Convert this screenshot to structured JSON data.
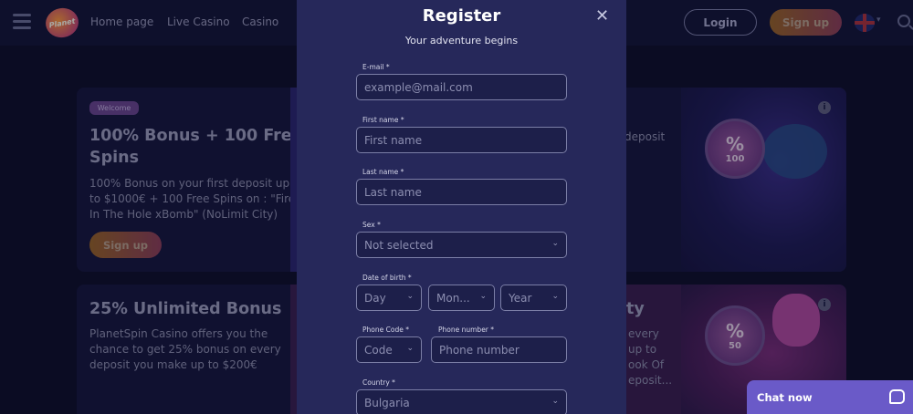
{
  "header": {
    "logo_text": "Planet",
    "nav": [
      "Home page",
      "Live Casino",
      "Casino"
    ],
    "login_label": "Login",
    "signup_label": "Sign up",
    "language_icon": "uk-flag-icon",
    "search_icon": "search-icon"
  },
  "promos": [
    {
      "badge": "Welcome",
      "title_line1": "100% Bonus + 100 Free",
      "title_line2": "Spins",
      "desc_lines": [
        "100% Bonus on your first deposit up",
        "to $1000€ + 100 Free Spins on : \"Fire",
        "In The Hole xBomb\" (NoLimit City)"
      ],
      "button": "Sign up",
      "side_text": "deposit",
      "coin_value": "100",
      "coin_symbol": "%"
    },
    {
      "title_line1": "25% Unlimited Bonus",
      "desc_lines": [
        "PlanetSpin Casino offers you the",
        "chance to get 25% bonus on every",
        "deposit you make up to $200€"
      ],
      "side_title": "ty",
      "side_lines": [
        "every",
        "up to",
        "ook Of",
        "eposit..."
      ],
      "coin_value": "50",
      "coin_symbol": "%"
    }
  ],
  "info_glyph": "i",
  "modal": {
    "title": "Register",
    "close_glyph": "✕",
    "subtitle": "Your adventure begins",
    "email_label": "E-mail *",
    "email_placeholder": "example@mail.com",
    "firstname_label": "First name *",
    "firstname_placeholder": "First name",
    "lastname_label": "Last name *",
    "lastname_placeholder": "Last name",
    "sex_label": "Sex *",
    "sex_value": "Not selected",
    "dob_label": "Date of birth *",
    "dob_day": "Day",
    "dob_month": "Mon...",
    "dob_year": "Year",
    "phonecode_label": "Phone Code *",
    "phonecode_value": "Code",
    "phone_label": "Phone number *",
    "phone_placeholder": "Phone number",
    "country_label": "Country *",
    "country_value": "Bulgaria",
    "chevron": "⌄"
  },
  "chat": {
    "label": "Chat now"
  }
}
